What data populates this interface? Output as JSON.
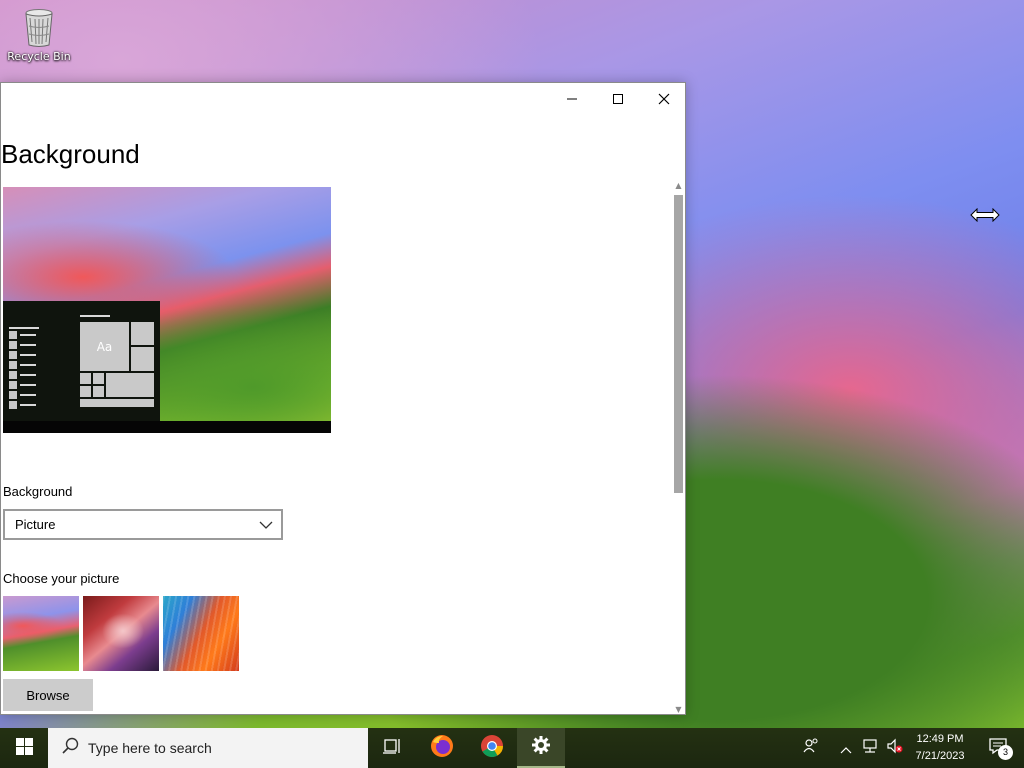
{
  "desktop": {
    "icons": [
      {
        "label": "Recycle Bin",
        "icon": "recycle-bin-icon"
      }
    ]
  },
  "window": {
    "title": "Background",
    "controls": {
      "minimize": "minimize-icon",
      "maximize": "maximize-icon",
      "close": "close-icon"
    },
    "preview": {
      "sample_text": "Aa"
    },
    "background_section": {
      "label": "Background",
      "selected": "Picture"
    },
    "picture_section": {
      "label": "Choose your picture",
      "thumbnails": [
        "sonoma-green-wallpaper",
        "red-canyon-wallpaper",
        "colorful-waves-wallpaper"
      ],
      "browse_label": "Browse"
    }
  },
  "taskbar": {
    "search_placeholder": "Type here to search",
    "apps": [
      "task-view-icon",
      "firefox-icon",
      "chrome-icon",
      "settings-icon"
    ],
    "clock": {
      "time": "12:49 PM",
      "date": "7/21/2023"
    },
    "notifications_count": "3"
  },
  "colors": {
    "taskbar": "#1f2a10",
    "accent_active": "#3a4628",
    "window_bg": "#ffffff"
  }
}
